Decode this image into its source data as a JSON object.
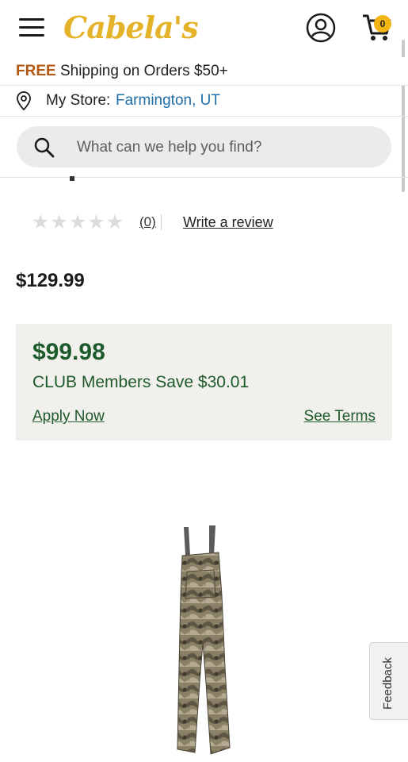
{
  "header": {
    "logo_text": "Cabela's",
    "cart_count": "0",
    "brand_color": "#e5b32a"
  },
  "promo": {
    "free": "FREE",
    "text": "Shipping on Orders $50+"
  },
  "store": {
    "label": "My Store:",
    "name": "Farmington, UT"
  },
  "search": {
    "placeholder": "What can we help you find?"
  },
  "rating": {
    "stars_filled": 0,
    "count": "(0)",
    "write_review": "Write a review"
  },
  "price": {
    "regular": "$129.99"
  },
  "club": {
    "price": "$99.98",
    "savings": "CLUB Members Save $30.01",
    "apply": "Apply Now",
    "terms": "See Terms",
    "color": "#1d5a2c"
  },
  "feedback": {
    "label": "Feedback"
  },
  "icons": [
    "hamburger-menu-icon",
    "account-icon",
    "cart-icon",
    "location-pin-icon",
    "search-icon",
    "star-icon"
  ]
}
